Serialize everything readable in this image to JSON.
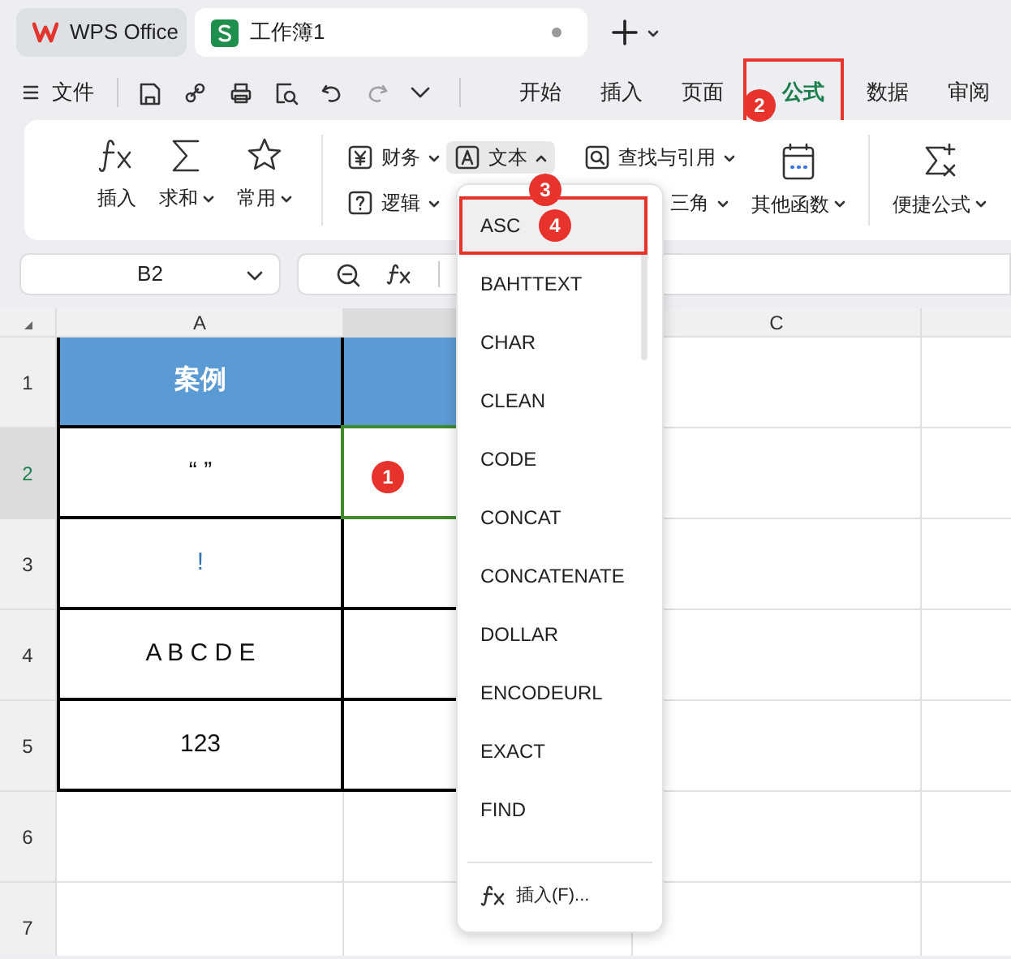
{
  "tabs": [
    {
      "label": "WPS Office",
      "kind": "app",
      "selected": false
    },
    {
      "label": "工作簿1",
      "kind": "doc",
      "selected": true,
      "unsaved": true
    }
  ],
  "menu": {
    "file": "文件",
    "tabs": [
      {
        "label": "开始",
        "selected": false
      },
      {
        "label": "插入",
        "selected": false
      },
      {
        "label": "页面",
        "selected": false
      },
      {
        "label": "公式",
        "selected": true,
        "annotation": "2"
      },
      {
        "label": "数据",
        "selected": false
      },
      {
        "label": "审阅",
        "selected": false
      }
    ]
  },
  "ribbon": {
    "left": [
      {
        "label": "插入",
        "dropdown": false
      },
      {
        "label": "求和",
        "dropdown": true
      },
      {
        "label": "常用",
        "dropdown": true
      }
    ],
    "middle": [
      {
        "label": "财务",
        "expanded": false
      },
      {
        "label": "文本",
        "expanded": true,
        "annotation": "3"
      },
      {
        "label": "查找与引用",
        "expanded": false
      },
      {
        "label": "逻辑",
        "expanded": false
      },
      {
        "label": "三角",
        "expanded": false
      }
    ],
    "right": [
      {
        "label": "其他函数",
        "dropdown": true
      },
      {
        "label": "便捷公式",
        "dropdown": true
      }
    ]
  },
  "formula_bar": {
    "name_box": "B2"
  },
  "grid": {
    "columns": [
      {
        "label": "A",
        "selected": false
      },
      {
        "selected": true
      },
      {
        "label": "C",
        "selected": false
      }
    ],
    "rows": [
      {
        "label": "1",
        "selected": false,
        "cells": [
          {
            "kind": "header",
            "text": "案例",
            "selected": false
          },
          {
            "kind": "header",
            "selected": false
          }
        ]
      },
      {
        "label": "2",
        "selected": true,
        "cells": [
          {
            "kind": "data",
            "text": "“ ”",
            "selected": false
          },
          {
            "kind": "data",
            "selected": true,
            "annotation": "1"
          }
        ]
      },
      {
        "label": "3",
        "selected": false,
        "cells": [
          {
            "kind": "data",
            "text": "!",
            "color": "#2e75b6",
            "selected": false
          },
          {
            "kind": "data",
            "selected": false
          }
        ]
      },
      {
        "label": "4",
        "selected": false,
        "cells": [
          {
            "kind": "data",
            "text": "A B C D E",
            "selected": false
          },
          {
            "kind": "data",
            "selected": false
          }
        ]
      },
      {
        "label": "5",
        "selected": false,
        "cells": [
          {
            "kind": "data",
            "text": "123",
            "selected": false
          },
          {
            "kind": "data",
            "selected": false
          }
        ]
      },
      {
        "label": "6",
        "selected": false,
        "cells": [
          {
            "kind": "empty",
            "selected": false
          },
          {
            "kind": "empty",
            "selected": false
          }
        ]
      },
      {
        "label": "7",
        "selected": false,
        "cells": [
          {
            "kind": "empty",
            "selected": false
          },
          {
            "kind": "empty",
            "selected": false
          }
        ]
      }
    ]
  },
  "dropdown": {
    "items": [
      {
        "label": "ASC",
        "selected": true,
        "annotation": "4"
      },
      {
        "label": "BAHTTEXT",
        "selected": false
      },
      {
        "label": "CHAR",
        "selected": false
      },
      {
        "label": "CLEAN",
        "selected": false
      },
      {
        "label": "CODE",
        "selected": false
      },
      {
        "label": "CONCAT",
        "selected": false
      },
      {
        "label": "CONCATENATE",
        "selected": false
      },
      {
        "label": "DOLLAR",
        "selected": false
      },
      {
        "label": "ENCODEURL",
        "selected": false
      },
      {
        "label": "EXACT",
        "selected": false
      },
      {
        "label": "FIND",
        "selected": false
      }
    ],
    "footer": "插入(F)..."
  }
}
